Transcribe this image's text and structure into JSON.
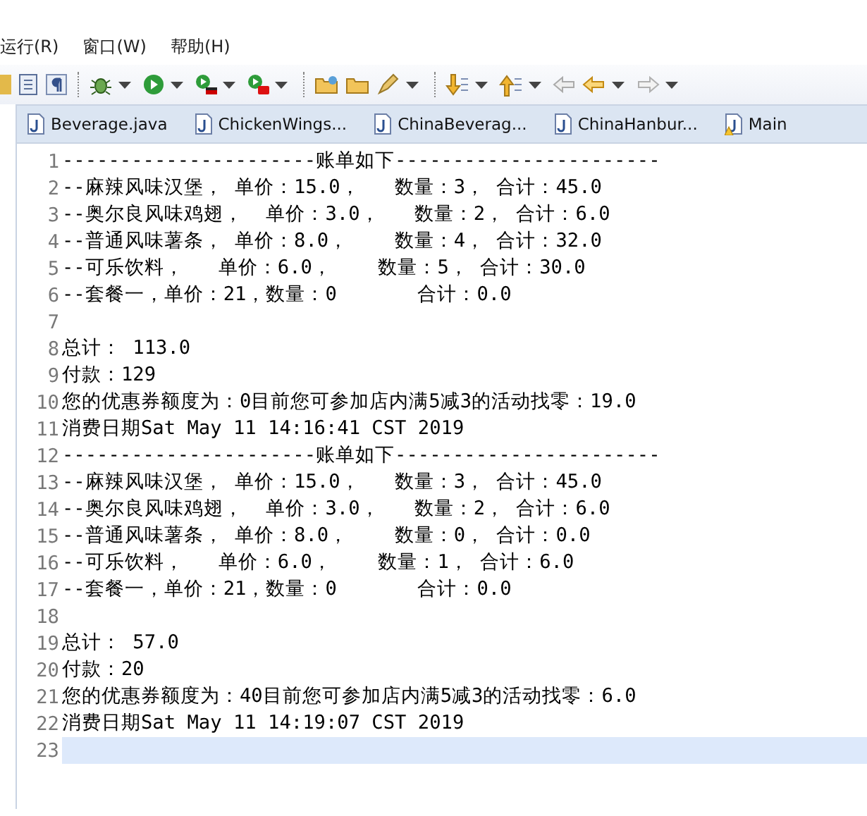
{
  "menu": [
    "运行(R)",
    "窗口(W)",
    "帮助(H)"
  ],
  "tabs": [
    {
      "label": "Beverage.java",
      "warning": false
    },
    {
      "label": "ChickenWings...",
      "warning": false
    },
    {
      "label": "ChinaBeverag...",
      "warning": false
    },
    {
      "label": "ChinaHanbur...",
      "warning": false
    },
    {
      "label": "Main",
      "warning": true
    }
  ],
  "editor": {
    "lines": [
      {
        "number": "1",
        "text": "----------------------账单如下-----------------------",
        "current": false
      },
      {
        "number": "2",
        "text": "--麻辣风味汉堡， 单价：15.0，   数量：3， 合计：45.0",
        "current": false
      },
      {
        "number": "3",
        "text": "--奥尔良风味鸡翅，  单价：3.0，   数量：2， 合计：6.0",
        "current": false
      },
      {
        "number": "4",
        "text": "--普通风味薯条， 单价：8.0，    数量：4， 合计：32.0",
        "current": false
      },
      {
        "number": "5",
        "text": "--可乐饮料，   单价：6.0，    数量：5， 合计：30.0",
        "current": false
      },
      {
        "number": "6",
        "text": "--套餐一，单价：21，数量：0       合计：0.0",
        "current": false
      },
      {
        "number": "7",
        "current": false
      },
      {
        "number": "8",
        "text": "总计： 113.0",
        "current": false
      },
      {
        "number": "9",
        "text": "付款：129",
        "current": false
      },
      {
        "number": "10",
        "text": "您的优惠券额度为：0目前您可参加店内满5减3的活动找零：19.0",
        "current": false
      },
      {
        "number": "11",
        "text": "消费日期Sat May 11 14:16:41 CST 2019",
        "current": false
      },
      {
        "number": "12",
        "text": "----------------------账单如下-----------------------",
        "current": false
      },
      {
        "number": "13",
        "text": "--麻辣风味汉堡， 单价：15.0，   数量：3， 合计：45.0",
        "current": false
      },
      {
        "number": "14",
        "text": "--奥尔良风味鸡翅，  单价：3.0，   数量：2， 合计：6.0",
        "current": false
      },
      {
        "number": "15",
        "text": "--普通风味薯条， 单价：8.0，    数量：0， 合计：0.0",
        "current": false
      },
      {
        "number": "16",
        "text": "--可乐饮料，   单价：6.0，    数量：1， 合计：6.0",
        "current": false
      },
      {
        "number": "17",
        "text": "--套餐一，单价：21，数量：0       合计：0.0",
        "current": false
      },
      {
        "number": "18",
        "current": false
      },
      {
        "number": "19",
        "text": "总计： 57.0",
        "current": false
      },
      {
        "number": "20",
        "text": "付款：20",
        "current": false
      },
      {
        "number": "21",
        "text": "您的优惠券额度为：40目前您可参加店内满5减3的活动找零：6.0",
        "current": false
      },
      {
        "number": "22",
        "text": "消费日期Sat May 11 14:19:07 CST 2019",
        "current": false
      },
      {
        "number": "23",
        "current": true
      }
    ]
  }
}
